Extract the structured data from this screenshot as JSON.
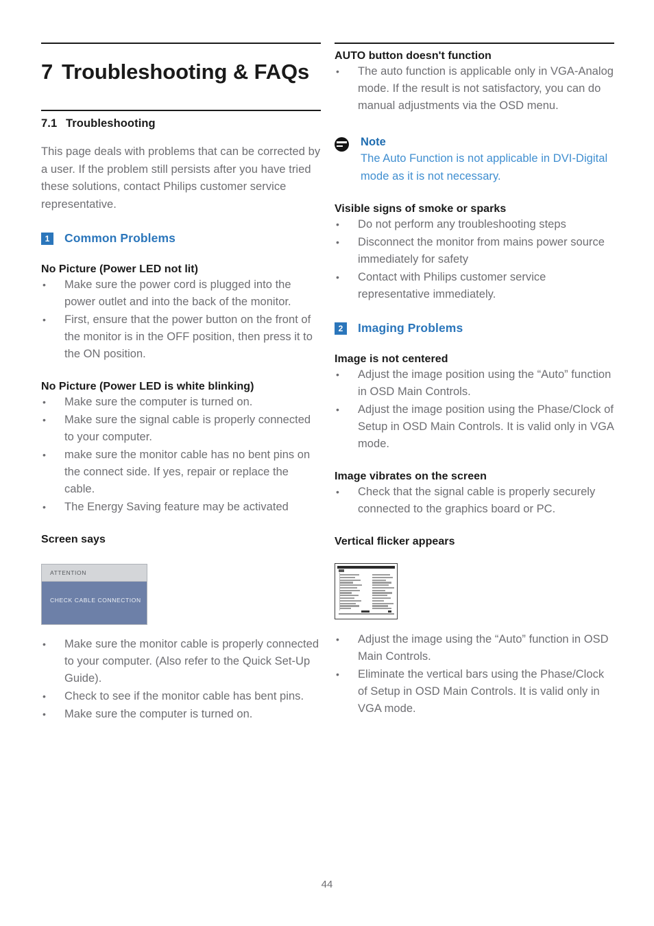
{
  "document": {
    "chapter_number": "7",
    "chapter_title": "Troubleshooting & FAQs",
    "section_number": "7.1",
    "section_title": "Troubleshooting",
    "intro": "This page deals with problems that can be corrected by a user. If the problem still persists after you have tried these solutions, contact Philips customer service representative.",
    "page_number": "44",
    "accent_blue": "#2b76bb",
    "note_blue": "#3f8ed0",
    "text_gray": "#6e6e72"
  },
  "left_column": {
    "group": {
      "badge": "1",
      "label": "Common Problems"
    },
    "blocks": [
      {
        "heading": "No Picture (Power LED not lit)",
        "bullets": [
          "Make sure the power cord is plugged into the power outlet and into the back of the monitor.",
          "First, ensure that the power button on the front of the monitor is in the OFF position, then press it to the ON position."
        ]
      },
      {
        "heading": "No Picture (Power LED is white blinking)",
        "bullets": [
          "Make sure the computer is turned on.",
          "Make sure the signal cable is properly connected to your computer.",
          "make sure the monitor cable has no bent pins on the connect side. If yes, repair or replace the cable.",
          "The Energy Saving feature may be activated"
        ]
      },
      {
        "heading": "Screen says",
        "bullets": [
          "Make sure the monitor cable is properly connected to your computer. (Also refer to the Quick Set-Up Guide).",
          "Check to see if the monitor cable has bent pins.",
          "Make sure the computer is turned on."
        ]
      }
    ],
    "osd_figure": {
      "header_text": "ATTENTION",
      "body_text": "CHECK CABLE CONNECTION",
      "header_color": "#d4d6d9",
      "body_color": "#6d80a8"
    }
  },
  "right_column": {
    "auto_button": {
      "heading": "AUTO button doesn't function",
      "bullets": [
        "The auto function is applicable only in VGA-Analog mode.  If the result is not satisfactory, you can do manual adjustments via the OSD menu."
      ]
    },
    "note": {
      "icon": "note-icon",
      "title": "Note",
      "body": "The Auto Function is not applicable in DVI-Digital mode as it is not necessary."
    },
    "smoke": {
      "heading": "Visible signs of smoke or sparks",
      "bullets": [
        "Do not perform any troubleshooting steps",
        "Disconnect the monitor from mains power source immediately for safety",
        "Contact with Philips customer service representative immediately."
      ]
    },
    "group": {
      "badge": "2",
      "label": "Imaging Problems"
    },
    "blocks": [
      {
        "heading": "Image is not centered",
        "bullets": [
          "Adjust the image position using the “Auto” function in OSD Main Controls.",
          "Adjust the image position using the Phase/Clock of Setup in OSD Main Controls.  It is valid only in VGA mode."
        ]
      },
      {
        "heading": "Image vibrates on the screen",
        "bullets": [
          "Check that the signal cable is properly securely connected to the graphics board or PC."
        ]
      },
      {
        "heading": "Vertical flicker appears",
        "bullets": [
          "Adjust the image using the “Auto” function in OSD Main Controls.",
          "Eliminate the vertical bars using the Phase/Clock of Setup in OSD Main Controls. It is valid only in VGA mode."
        ]
      }
    ]
  }
}
